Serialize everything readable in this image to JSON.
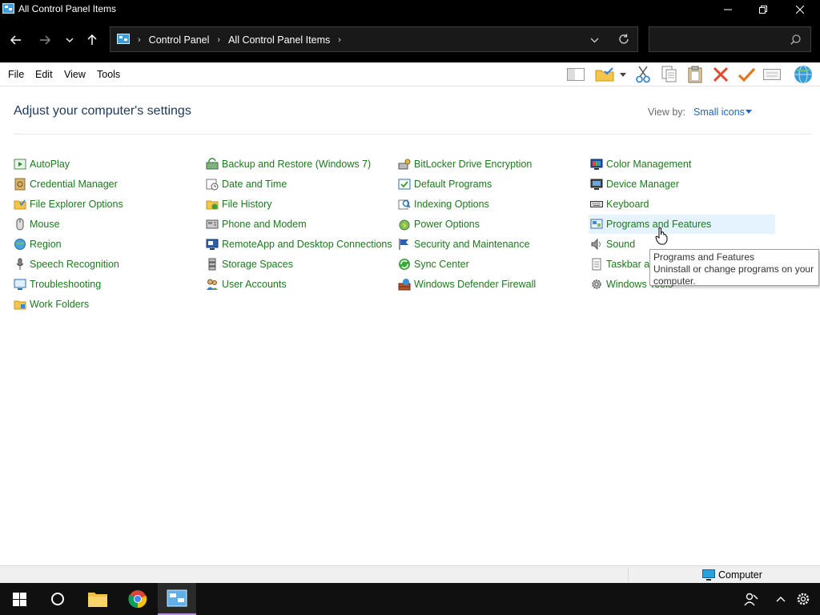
{
  "window": {
    "title": "All Control Panel Items"
  },
  "address": {
    "crumbs": [
      "Control Panel",
      "All Control Panel Items"
    ]
  },
  "search": {
    "placeholder": ""
  },
  "menu": [
    "File",
    "Edit",
    "View",
    "Tools"
  ],
  "header": {
    "title": "Adjust your computer's settings",
    "view_by_label": "View by:",
    "view_by_value": "Small icons"
  },
  "items": {
    "col1": [
      "AutoPlay",
      "Credential Manager",
      "File Explorer Options",
      "Mouse",
      "Region",
      "Speech Recognition",
      "Troubleshooting",
      "Work Folders"
    ],
    "col2": [
      "Backup and Restore (Windows 7)",
      "Date and Time",
      "File History",
      "Phone and Modem",
      "RemoteApp and Desktop Connections",
      "Storage Spaces",
      "User Accounts"
    ],
    "col3": [
      "BitLocker Drive Encryption",
      "Default Programs",
      "Indexing Options",
      "Power Options",
      "Security and Maintenance",
      "Sync Center",
      "Windows Defender Firewall"
    ],
    "col4": [
      "Color Management",
      "Device Manager",
      "Keyboard",
      "Programs and Features",
      "Sound",
      "Taskbar ar",
      "Windows Tools"
    ]
  },
  "tooltip": {
    "title": "Programs and Features",
    "desc": "Uninstall or change programs on your computer."
  },
  "status": {
    "location": "Computer"
  },
  "colors": {
    "link": "#1b7a1b",
    "heading": "#1e395b",
    "accent": "#1e66c5"
  }
}
